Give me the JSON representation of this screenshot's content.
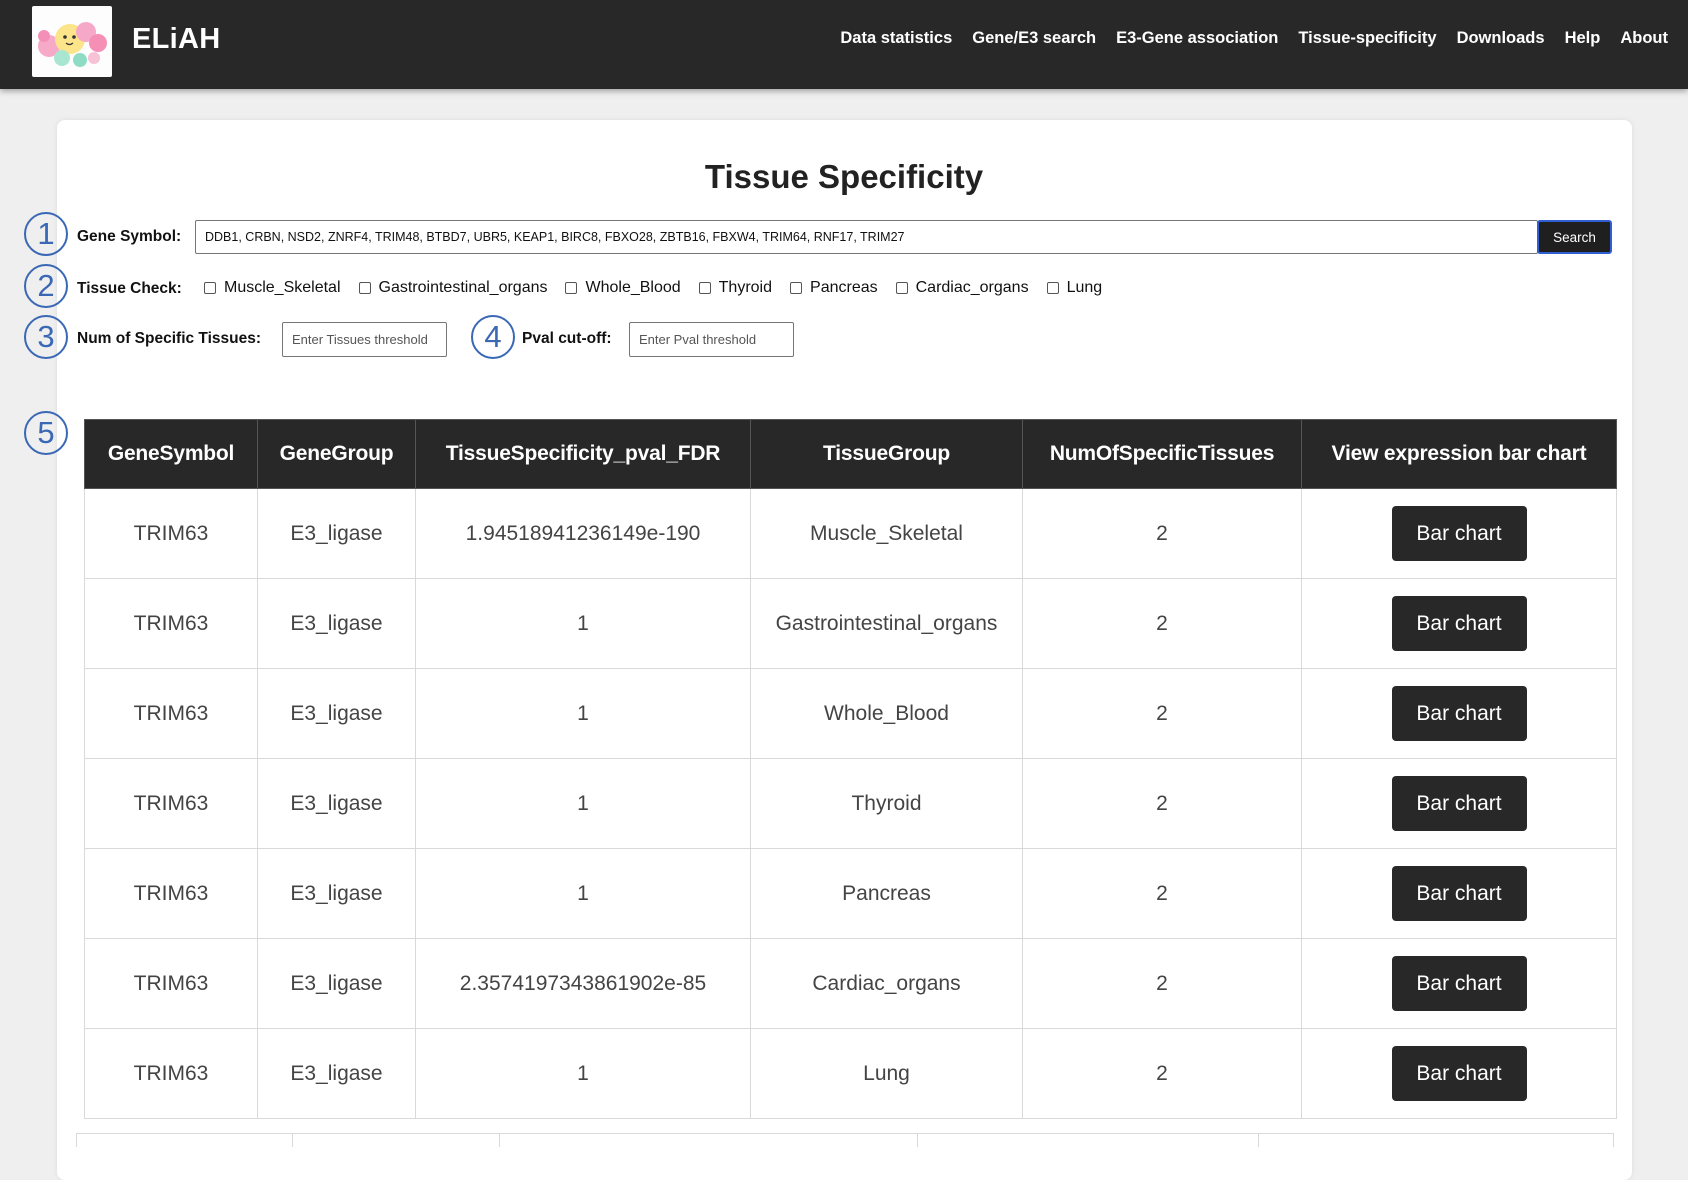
{
  "brand": "ELiAH",
  "nav": [
    "Data statistics",
    "Gene/E3 search",
    "E3-Gene association",
    "Tissue-specificity",
    "Downloads",
    "Help",
    "About"
  ],
  "title": "Tissue Specificity",
  "annotations": [
    "1",
    "2",
    "3",
    "4",
    "5"
  ],
  "form": {
    "gene_label": "Gene Symbol:",
    "gene_value": "DDB1, CRBN, NSD2, ZNRF4, TRIM48, BTBD7, UBR5, KEAP1, BIRC8, FBXO28, ZBTB16, FBXW4, TRIM64, RNF17, TRIM27",
    "search_label": "Search",
    "tissue_label": "Tissue Check:",
    "tissues": [
      "Muscle_Skeletal",
      "Gastrointestinal_organs",
      "Whole_Blood",
      "Thyroid",
      "Pancreas",
      "Cardiac_organs",
      "Lung"
    ],
    "num_label": "Num of Specific Tissues:",
    "num_placeholder": "Enter Tissues threshold",
    "pval_label": "Pval cut-off:",
    "pval_placeholder": "Enter Pval threshold"
  },
  "table": {
    "headers": [
      "GeneSymbol",
      "GeneGroup",
      "TissueSpecificity_pval_FDR",
      "TissueGroup",
      "NumOfSpecificTissues",
      "View expression bar chart"
    ],
    "rows": [
      {
        "gene": "TRIM63",
        "group": "E3_ligase",
        "pval": "1.94518941236149e-190",
        "tissue": "Muscle_Skeletal",
        "num": "2",
        "action": "Bar chart"
      },
      {
        "gene": "TRIM63",
        "group": "E3_ligase",
        "pval": "1",
        "tissue": "Gastrointestinal_organs",
        "num": "2",
        "action": "Bar chart"
      },
      {
        "gene": "TRIM63",
        "group": "E3_ligase",
        "pval": "1",
        "tissue": "Whole_Blood",
        "num": "2",
        "action": "Bar chart"
      },
      {
        "gene": "TRIM63",
        "group": "E3_ligase",
        "pval": "1",
        "tissue": "Thyroid",
        "num": "2",
        "action": "Bar chart"
      },
      {
        "gene": "TRIM63",
        "group": "E3_ligase",
        "pval": "1",
        "tissue": "Pancreas",
        "num": "2",
        "action": "Bar chart"
      },
      {
        "gene": "TRIM63",
        "group": "E3_ligase",
        "pval": "2.3574197343861902e-85",
        "tissue": "Cardiac_organs",
        "num": "2",
        "action": "Bar chart"
      },
      {
        "gene": "TRIM63",
        "group": "E3_ligase",
        "pval": "1",
        "tissue": "Lung",
        "num": "2",
        "action": "Bar chart"
      }
    ]
  }
}
